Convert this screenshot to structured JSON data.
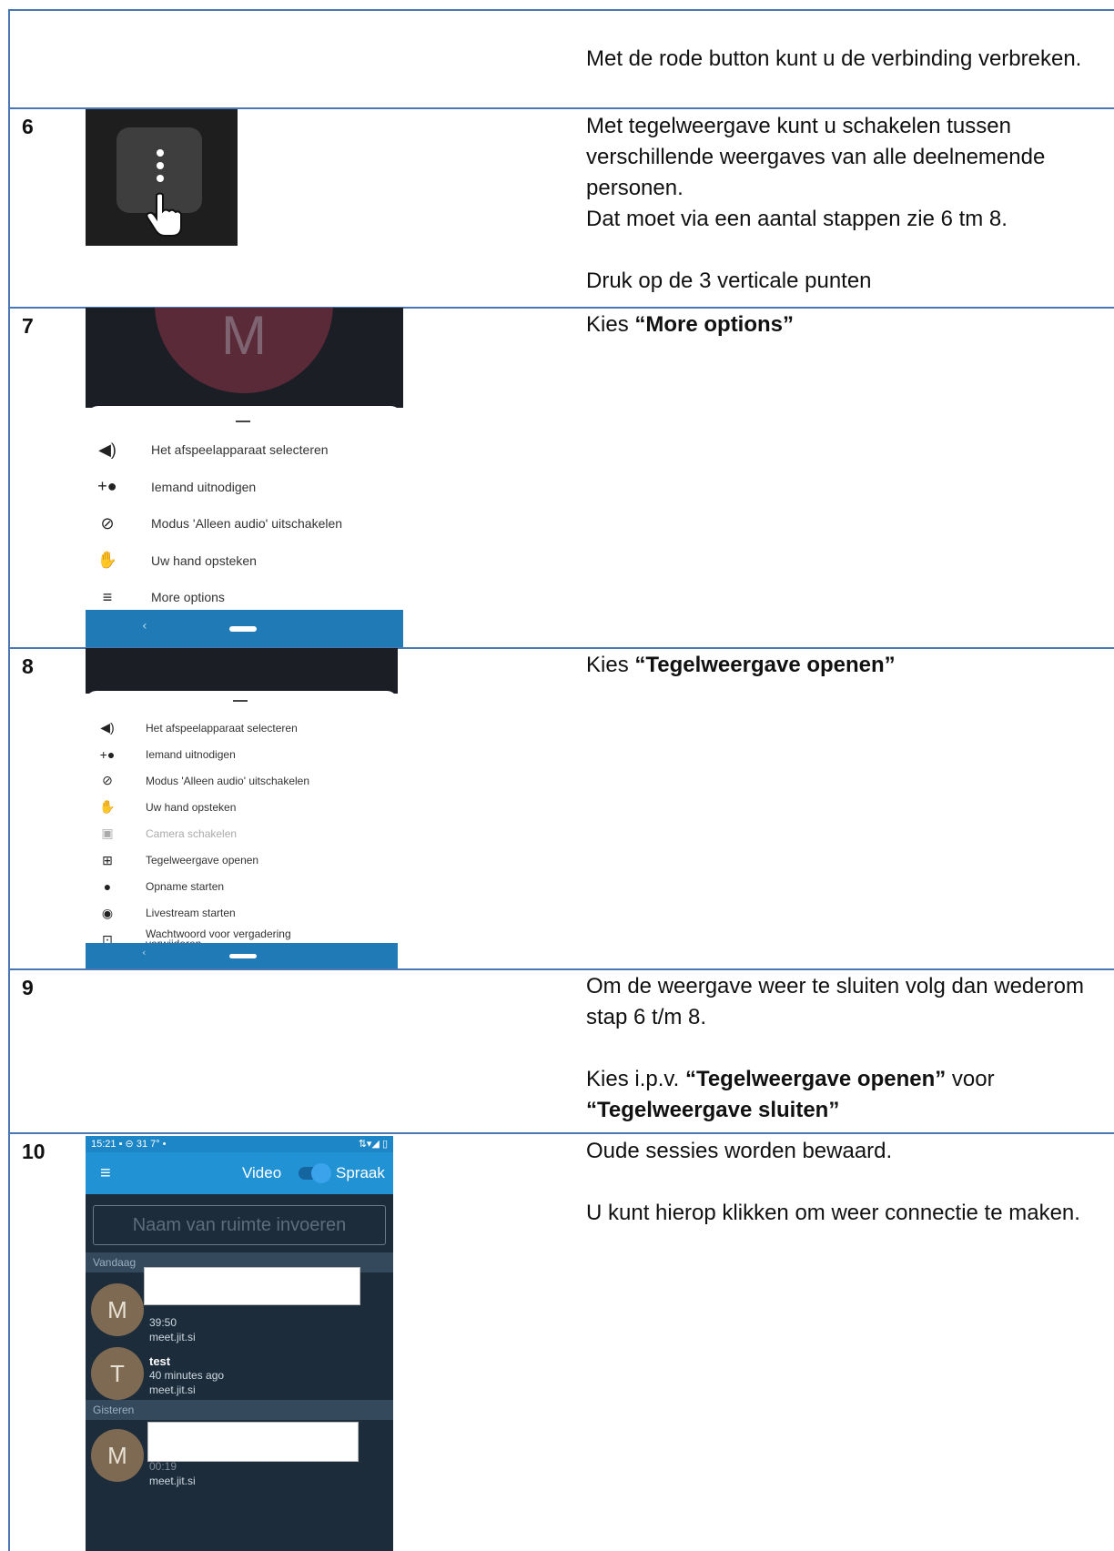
{
  "rows": [
    {
      "num": "",
      "lines": [
        "Met de rode button kunt u de verbinding verbreken."
      ]
    },
    {
      "num": "6",
      "lines": [
        "Met tegelweergave kunt u schakelen tussen verschillende weergaves van alle deelnemende personen.",
        "Dat moet via een aantal stappen zie 6 tm 8.",
        "",
        "Druk op de 3 verticale punten"
      ]
    },
    {
      "num": "7",
      "prefix": "Kies ",
      "bold": "“More options”"
    },
    {
      "num": "8",
      "prefix": "Kies ",
      "bold": "“Tegelweergave openen”"
    },
    {
      "num": "9",
      "line1": "Om de weergave weer te sluiten volg dan wederom stap 6 t/m 8.",
      "line2_prefix": "Kies i.p.v. ",
      "line2_bold": "“Tegelweergave openen”",
      "line2_mid": " voor ",
      "line2_bold2": "“Tegelweergave sluiten”"
    },
    {
      "num": "10",
      "line1": "Oude sessies worden bewaard.",
      "line2": "U kunt hierop klikken om weer connectie te maken."
    }
  ],
  "menu7": {
    "avatar_letter": "M",
    "items": [
      {
        "icon": "speaker-icon",
        "label": "Het afspeelapparaat selecteren"
      },
      {
        "icon": "add-person-icon",
        "label": "Iemand uitnodigen"
      },
      {
        "icon": "eye-off-icon",
        "label": "Modus 'Alleen audio' uitschakelen"
      },
      {
        "icon": "hand-icon",
        "label": "Uw hand opsteken"
      },
      {
        "icon": "menu-icon",
        "label": "More options"
      }
    ]
  },
  "menu8": {
    "items": [
      {
        "icon": "speaker-icon",
        "label": "Het afspeelapparaat selecteren"
      },
      {
        "icon": "add-person-icon",
        "label": "Iemand uitnodigen"
      },
      {
        "icon": "eye-off-icon",
        "label": "Modus 'Alleen audio' uitschakelen"
      },
      {
        "icon": "hand-icon",
        "label": "Uw hand opsteken"
      },
      {
        "icon": "camera-switch-icon",
        "label": "Camera schakelen"
      },
      {
        "icon": "grid-icon",
        "label": "Tegelweergave openen"
      },
      {
        "icon": "record-icon",
        "label": "Opname starten"
      },
      {
        "icon": "livestream-icon",
        "label": "Livestream starten"
      },
      {
        "icon": "lock-icon",
        "label": "Wachtwoord voor vergadering verwijderen"
      }
    ]
  },
  "phone": {
    "time": "15:21",
    "status_icons": "▪ ⊝ 31 7° •",
    "status_right": "⇅▾◢ ▯",
    "video_label": "Video",
    "speech_label": "Spraak",
    "room_placeholder": "Naam van ruimte invoeren",
    "section_today": "Vandaag",
    "section_yesterday": "Gisteren",
    "sessions": [
      {
        "letter": "M",
        "name": "",
        "time": "39:50",
        "host": "meet.jit.si"
      },
      {
        "letter": "T",
        "name": "test",
        "time": "40 minutes ago",
        "host": "meet.jit.si"
      },
      {
        "letter": "M",
        "name": "",
        "time": "00:19",
        "host": "meet.jit.si"
      }
    ]
  }
}
